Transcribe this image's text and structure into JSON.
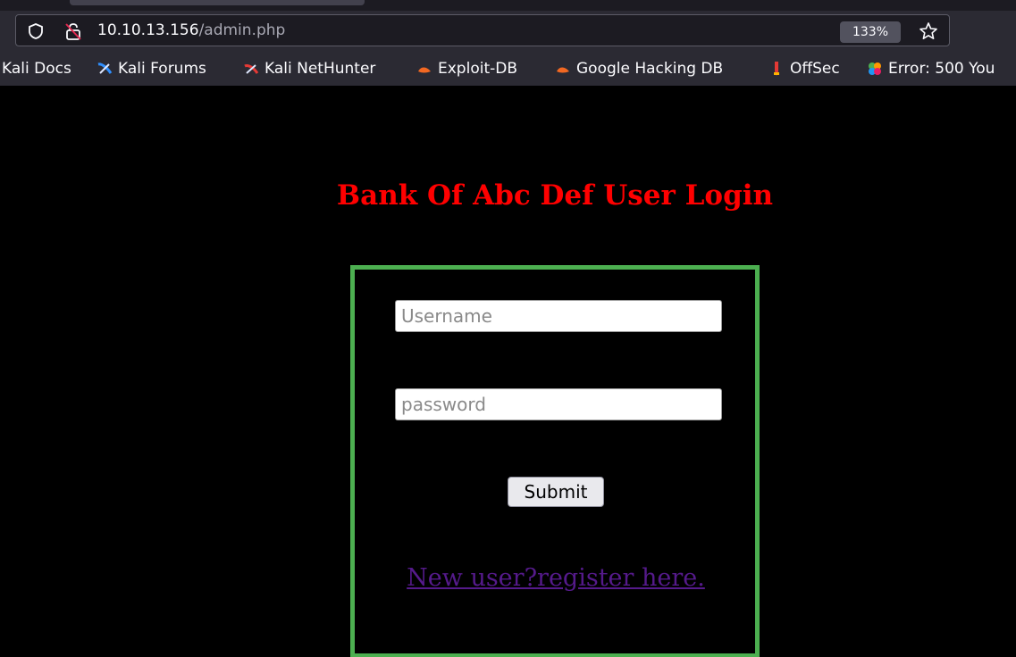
{
  "browser": {
    "url_host": "10.10.13.156",
    "url_path": "/admin.php",
    "zoom": "133%",
    "bookmarks": [
      {
        "label": "Kali Docs",
        "icon": "kali-docs-icon"
      },
      {
        "label": "Kali Forums",
        "icon": "kali-forums-icon"
      },
      {
        "label": "Kali NetHunter",
        "icon": "kali-nethunter-icon"
      },
      {
        "label": "Exploit-DB",
        "icon": "exploit-db-icon"
      },
      {
        "label": "Google Hacking DB",
        "icon": "ghdb-icon"
      },
      {
        "label": "OffSec",
        "icon": "offsec-icon"
      },
      {
        "label": "Error: 500 You",
        "icon": "error-bookmark-icon"
      }
    ]
  },
  "page": {
    "title": "Bank Of Abc Def User Login",
    "username_placeholder": "Username",
    "password_placeholder": "password",
    "submit_label": "Submit",
    "register_label": "New user?register here.",
    "colors": {
      "title": "#ff0000",
      "box_border": "#4caf50",
      "link": "#551a8b",
      "background": "#000000"
    }
  }
}
